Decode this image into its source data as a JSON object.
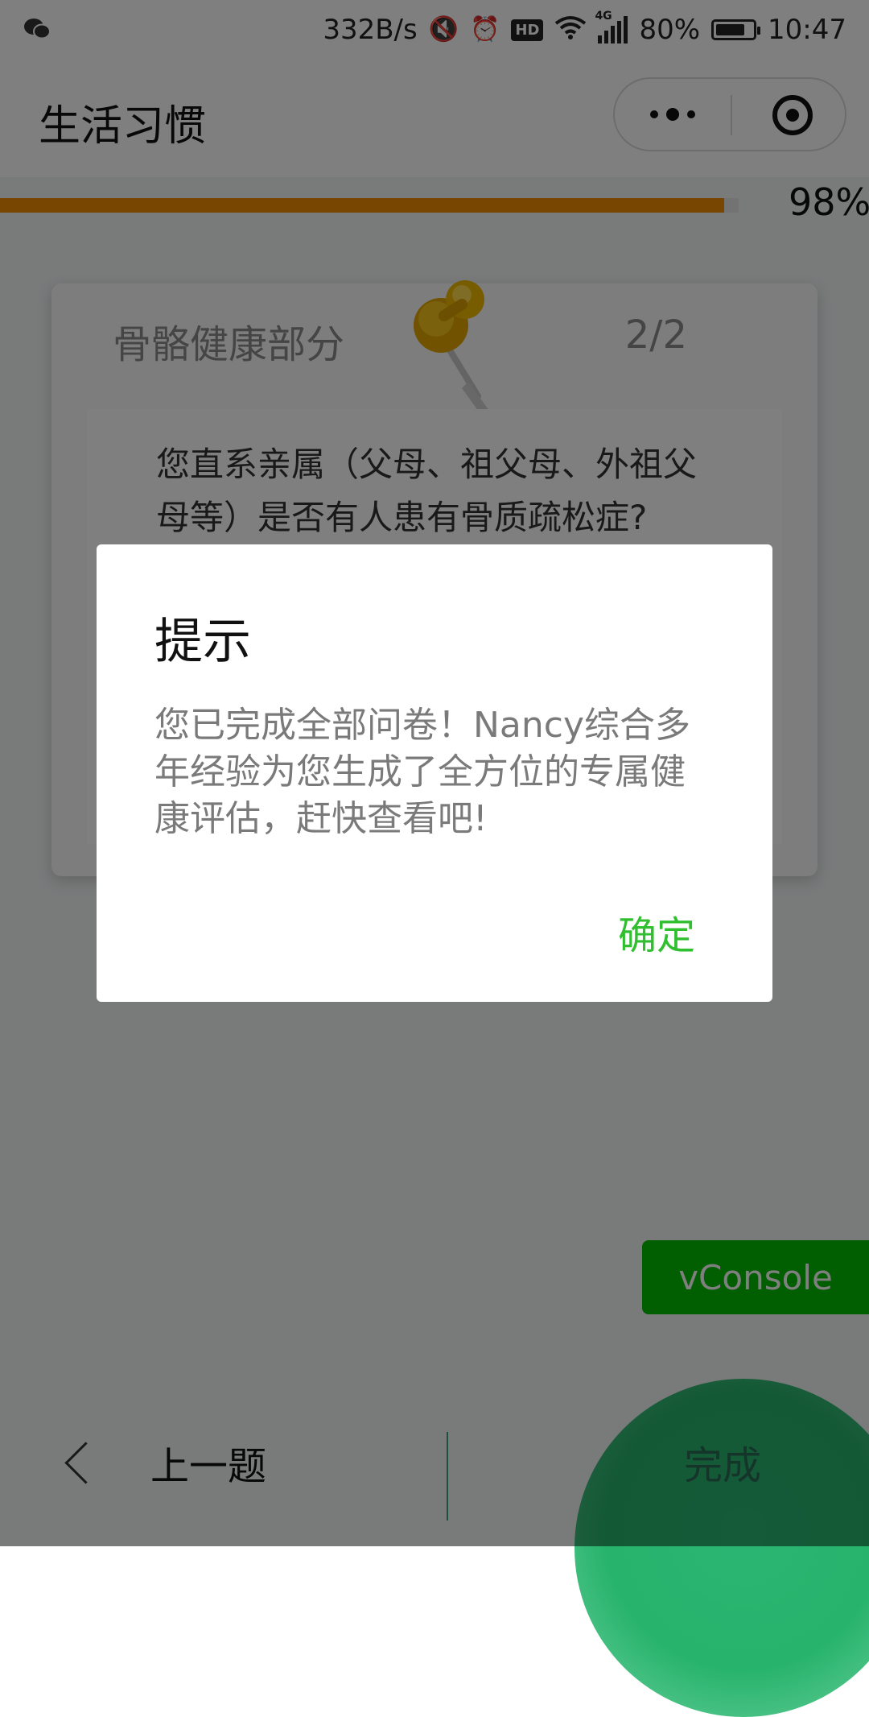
{
  "status_bar": {
    "network_speed": "332B/s",
    "signal_tag": "4G",
    "battery": "80%",
    "battery_level": 0.8,
    "time": "10:47",
    "hd": "HD"
  },
  "nav": {
    "title": "生活习惯"
  },
  "progress": {
    "percent_text": "98%",
    "value": 0.98,
    "color": "#f08c00"
  },
  "card": {
    "section_title": "骨骼健康部分",
    "counter": "2/2",
    "question": "您直系亲属（父母、祖父母、外祖父母等）是否有人患有骨质疏松症?"
  },
  "bottom": {
    "prev_label": "上一题",
    "finish_label": "完成"
  },
  "vconsole": {
    "label": "vConsole"
  },
  "dialog": {
    "title": "提示",
    "content": "您已完成全部问卷！Nancy综合多年经验为您生成了全方位的专属健康评估，赶快查看吧!",
    "confirm_label": "确定",
    "confirm_color": "#2fbf2f"
  }
}
